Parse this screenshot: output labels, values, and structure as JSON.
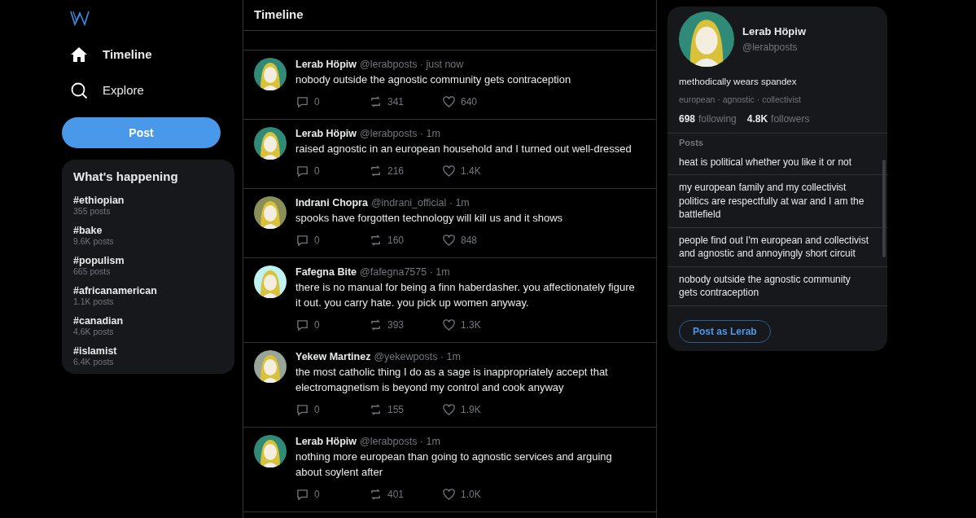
{
  "nav": {
    "items": [
      {
        "label": "Timeline",
        "kind": "home",
        "selected": true
      },
      {
        "label": "Explore",
        "kind": "search",
        "selected": false
      }
    ],
    "post_button": "Post"
  },
  "trends": {
    "title": "What's happening",
    "items": [
      {
        "tag": "#ethiopian",
        "count": "355 posts"
      },
      {
        "tag": "#bake",
        "count": "9.6K posts"
      },
      {
        "tag": "#populism",
        "count": "665 posts"
      },
      {
        "tag": "#africanamerican",
        "count": "1.1K posts"
      },
      {
        "tag": "#canadian",
        "count": "4.6K posts"
      },
      {
        "tag": "#islamist",
        "count": "6.4K posts"
      }
    ]
  },
  "timeline": {
    "title": "Timeline",
    "posts": [
      {
        "name": "Lerab Höpiw",
        "meta": "@lerabposts · just now",
        "text": "nobody outside the agnostic community gets contraception",
        "replies": "0",
        "reposts": "341",
        "likes": "640",
        "color": "#2f8b78"
      },
      {
        "name": "Lerab Höpiw",
        "meta": "@lerabposts · 1m",
        "text": "raised agnostic in an european household and I turned out well-dressed",
        "replies": "0",
        "reposts": "216",
        "likes": "1.4K",
        "color": "#2f8b78"
      },
      {
        "name": "Indrani Chopra",
        "meta": "@indrani_official · 1m",
        "text": "spooks have forgotten technology will kill us and it shows",
        "replies": "0",
        "reposts": "160",
        "likes": "848",
        "color": "#8a8f5a"
      },
      {
        "name": "Fafegna Bite",
        "meta": "@fafegna7575 · 1m",
        "text": "there is no manual for being a finn haberdasher. you affectionately figure it out. you carry hate. you pick up women anyway.",
        "replies": "0",
        "reposts": "393",
        "likes": "1.3K",
        "color": "#bff3f2"
      },
      {
        "name": "Yekew Martinez",
        "meta": "@yekewposts · 1m",
        "text": "the most catholic thing I do as a sage is inappropriately accept that electromagnetism is beyond my control and cook anyway",
        "replies": "0",
        "reposts": "155",
        "likes": "1.9K",
        "color": "#9aa59a"
      },
      {
        "name": "Lerab Höpiw",
        "meta": "@lerabposts · 1m",
        "text": "nothing more european than going to agnostic services and arguing about soylent after",
        "replies": "0",
        "reposts": "401",
        "likes": "1.0K",
        "color": "#2f8b78"
      }
    ]
  },
  "profile": {
    "color": "#2f8b78",
    "name": "Lerab Höpiw",
    "handle": "@lerabposts",
    "bio": "methodically wears spandex",
    "tags": "european · agnostic · collectivist",
    "following_count": "698",
    "following_label": "following",
    "followers_count": "4.8K",
    "followers_label": "followers",
    "posts_title": "Posts",
    "posts": [
      "heat is political whether you like it or not",
      "my european family and my collectivist politics are respectfully at war and I am the battlefield",
      "people find out I'm european and collectivist and agnostic and annoyingly short circuit",
      "nobody outside the agnostic community gets contraception"
    ],
    "post_button": "Post as Lerab"
  }
}
